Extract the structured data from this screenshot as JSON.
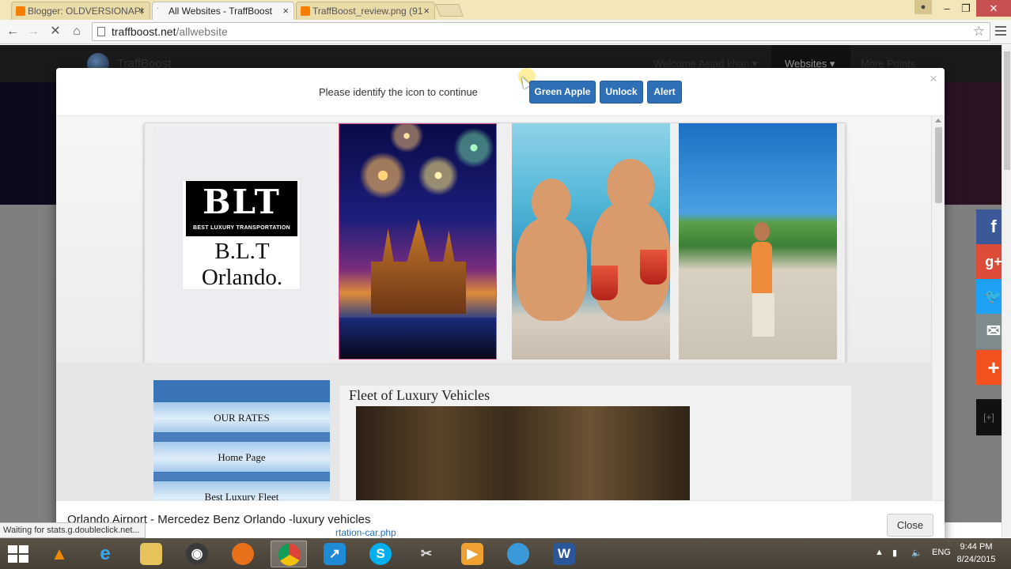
{
  "browser": {
    "tabs": [
      {
        "label": "Blogger: OLDVERSIONAPI",
        "active": false
      },
      {
        "label": "All Websites - TraffBoost",
        "active": true
      },
      {
        "label": "TraffBoost_review.png (91",
        "active": false
      }
    ],
    "url_host": "traffboost.net",
    "url_path": "/allwebsite",
    "status_text": "Waiting for stats.g.doubleclick.net...",
    "link_preview": "rtation-car.php"
  },
  "site": {
    "brand": "TraffBoost",
    "welcome": "Welcome Asjad khan ▾",
    "nav_websites": "Websites ▾",
    "nav_more": "More Points"
  },
  "modal": {
    "prompt": "Please identify the icon to continue",
    "captcha_buttons": [
      "Green Apple",
      "Unlock",
      "Alert"
    ],
    "close_x": "×",
    "footer_title": "Orlando Airport - Mercedez Benz Orlando -luxury vehicles",
    "footer_close": "Close"
  },
  "embedded_site": {
    "logo_mark": "BLT",
    "logo_subtitle": "BEST LUXURY TRANSPORTATION",
    "logo_title_line1": "B.L.T",
    "logo_title_line2": "Orlando.",
    "menu": [
      "OUR RATES",
      "Home Page",
      "Best Luxury Fleet"
    ],
    "section_title": "Fleet of Luxury Vehicles"
  },
  "share_buttons": [
    {
      "name": "facebook",
      "glyph": "f",
      "color": "#3b5998"
    },
    {
      "name": "google-plus",
      "glyph": "g+",
      "color": "#dd4b39"
    },
    {
      "name": "twitter",
      "glyph": "🐦",
      "color": "#1da1f2"
    },
    {
      "name": "email",
      "glyph": "✉",
      "color": "#7f8c8d"
    },
    {
      "name": "more",
      "glyph": "+",
      "color": "#f4511e"
    }
  ],
  "taskbar": {
    "language": "ENG",
    "time": "9:44 PM",
    "date": "8/24/2015"
  },
  "colors": {
    "captcha_button": "#2f6fb5",
    "menu_blue": "#3c74b8",
    "site_nav": "#1a1a1a"
  }
}
